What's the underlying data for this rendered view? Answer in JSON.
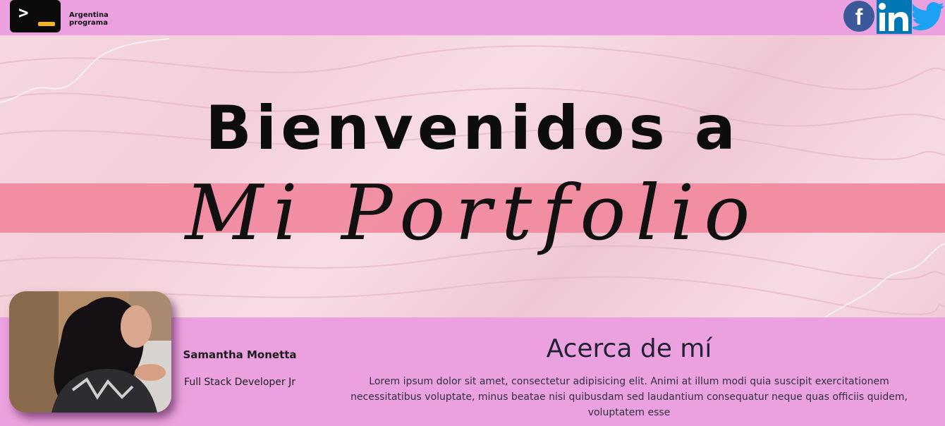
{
  "brand": {
    "line1": "Argentina",
    "line2": "programa"
  },
  "social": {
    "facebook_icon": "facebook-icon",
    "linkedin_icon": "linkedin-icon",
    "twitter_icon": "twitter-icon"
  },
  "hero": {
    "title": "Bienvenidos a",
    "script": "Mi Portfolio"
  },
  "profile": {
    "name": "Samantha Monetta",
    "role": "Full Stack Developer Jr"
  },
  "about": {
    "title": "Acerca de mí",
    "text": "Lorem ipsum dolor sit amet, consectetur adipisicing elit. Animi at illum modi quia suscipit exercitationem necessitatibus voluptate, minus beatae nisi quibusdam sed laudantium consequatur neque quas officiis quidem, voluptatem esse"
  },
  "colors": {
    "background": "#eba1df",
    "stripe": "#f08a9f",
    "facebook": "#3b5998",
    "linkedin": "#0077b5",
    "twitter": "#1da1f2",
    "logo_accent": "#f6b51e"
  }
}
